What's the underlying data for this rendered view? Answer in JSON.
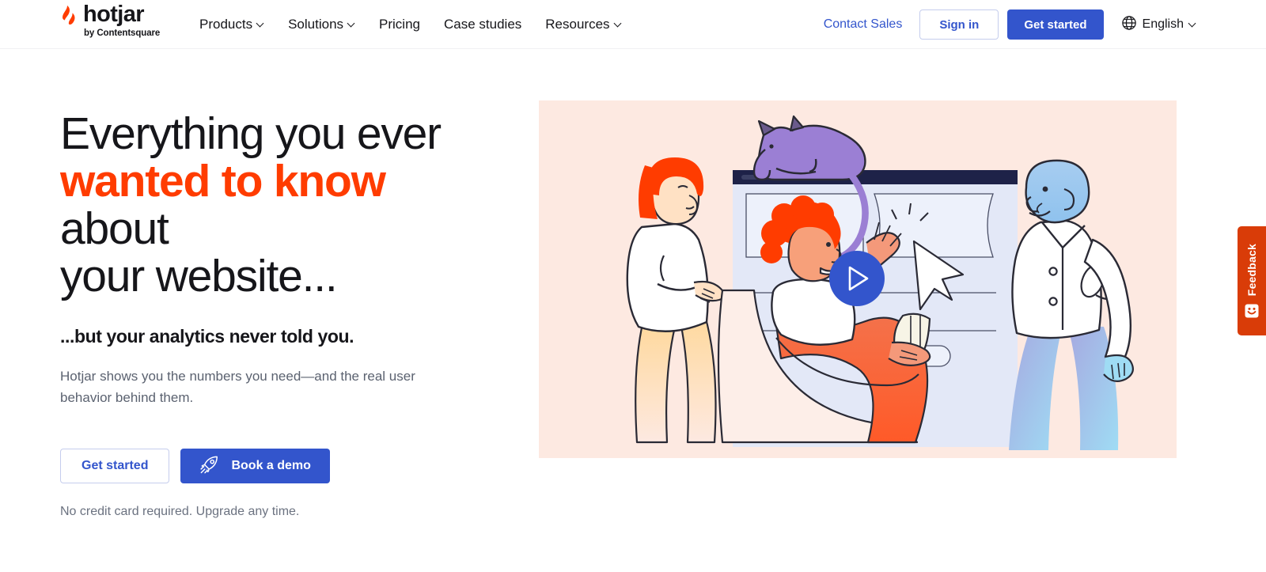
{
  "header": {
    "logo": {
      "word": "hotjar",
      "tagline": "by Contentsquare",
      "mark_icon": "hotjar-flame-icon"
    },
    "nav": [
      {
        "label": "Products",
        "has_caret": true
      },
      {
        "label": "Solutions",
        "has_caret": true
      },
      {
        "label": "Pricing",
        "has_caret": false
      },
      {
        "label": "Case studies",
        "has_caret": false
      },
      {
        "label": "Resources",
        "has_caret": true
      }
    ],
    "contact_sales": "Contact Sales",
    "sign_in": "Sign in",
    "get_started": "Get started",
    "language": {
      "label": "English",
      "icon": "globe-icon",
      "caret": true
    }
  },
  "hero": {
    "headline": {
      "line1": "Everything you ever",
      "accent": "wanted to know",
      "line2_rest": " about",
      "line3": "your website..."
    },
    "subheadline": "...but your analytics never told you.",
    "body": "Hotjar shows you the numbers you need—and the real user behavior behind them.",
    "cta_primary": "Get started",
    "cta_secondary": "Book a demo",
    "cta_secondary_icon": "rocket-icon",
    "fine_print": "No credit card required. Upgrade any time.",
    "illustration": {
      "alt": "Three people and a cat around a browser window with a video play button",
      "play_button_icon": "play-icon"
    }
  },
  "feedback_tab": {
    "label": "Feedback",
    "icon": "smiley-face-icon"
  },
  "colors": {
    "accent_orange": "#FF3C00",
    "brand_blue": "#3355CC",
    "text_dark": "#16161A",
    "text_muted": "#5B6270",
    "illustration_bg": "#FDE9E1",
    "feedback_red": "#D93C08",
    "cat_purple": "#9B7FD4",
    "browser_navy": "#1E2248"
  }
}
